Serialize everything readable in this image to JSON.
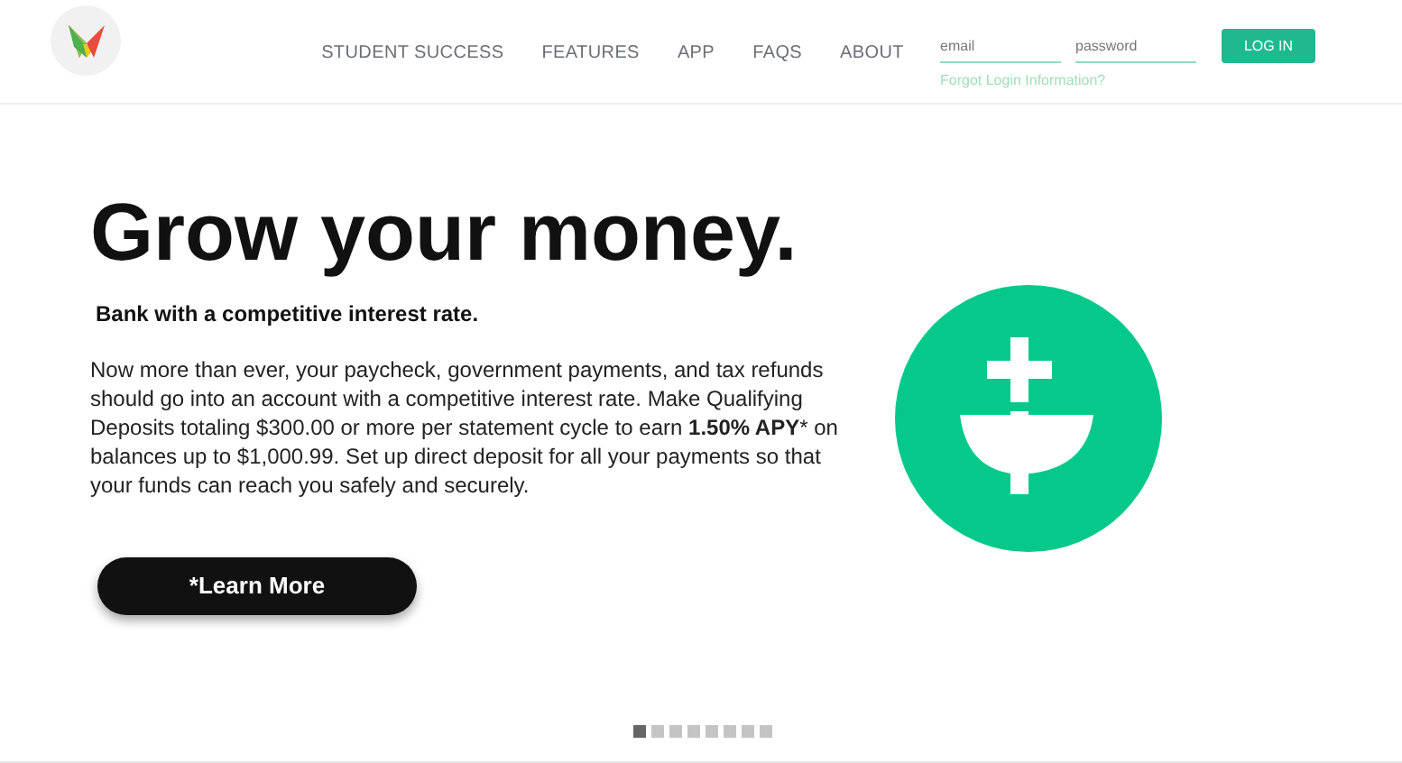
{
  "nav": {
    "items": [
      "STUDENT SUCCESS",
      "FEATURES",
      "APP",
      "FAQS",
      "ABOUT"
    ]
  },
  "login": {
    "email_placeholder": "email",
    "password_placeholder": "password",
    "button": "LOG IN",
    "forgot": "Forgot Login Information?"
  },
  "hero": {
    "title": "Grow your money.",
    "subtitle": "Bank with a competitive interest rate.",
    "body": "Now more than ever, your paycheck, government payments, and tax refunds should go into an account with a competitive interest rate. Make Qualifying Deposits totaling $300.00 or more per statement cycle to earn **1.50% APY*** on balances up to $1,000.99. Set up direct deposit for all your payments so that your funds can reach you safely and securely.",
    "button": "*Learn More"
  },
  "slides": [
    {
      "selected": true
    },
    {
      "selected": false
    },
    {
      "selected": false
    },
    {
      "selected": false
    },
    {
      "selected": false
    },
    {
      "selected": false
    },
    {
      "selected": false
    },
    {
      "selected": false
    }
  ]
}
